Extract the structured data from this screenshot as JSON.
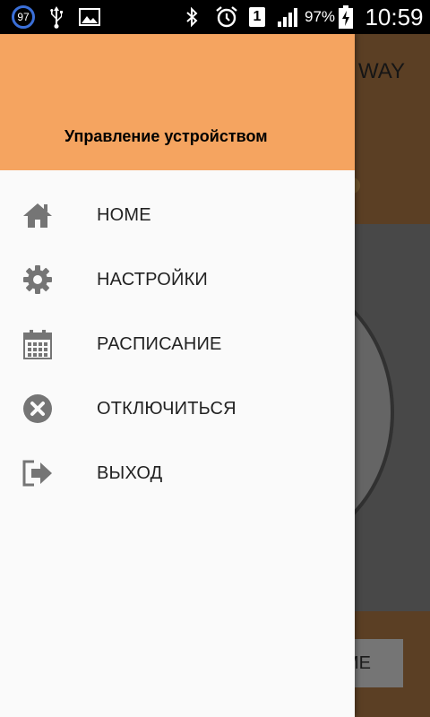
{
  "status_bar": {
    "notification_count": "97",
    "battery_percent": "97%",
    "sim_slot": "1",
    "time": "10:59",
    "icons": [
      "notification-badge",
      "usb-icon",
      "image-icon",
      "bluetooth-icon",
      "alarm-icon",
      "sim-icon",
      "signal-icon",
      "battery-charging-icon"
    ]
  },
  "app": {
    "toolbar_title_partial": "WAY",
    "button_label_partial": "ME"
  },
  "drawer": {
    "header_title": "Управление устройством",
    "items": [
      {
        "label": "HOME",
        "icon": "home-icon"
      },
      {
        "label": "НАСТРОЙКИ",
        "icon": "gear-icon"
      },
      {
        "label": "РАСПИСАНИЕ",
        "icon": "calendar-icon"
      },
      {
        "label": "ОТКЛЮЧИТЬСЯ",
        "icon": "close-circle-icon"
      },
      {
        "label": "ВЫХОД",
        "icon": "logout-icon"
      }
    ]
  },
  "colors": {
    "drawer_header": "#f5a460",
    "app_brown": "#6b4a2b",
    "icon_gray": "#757575"
  }
}
